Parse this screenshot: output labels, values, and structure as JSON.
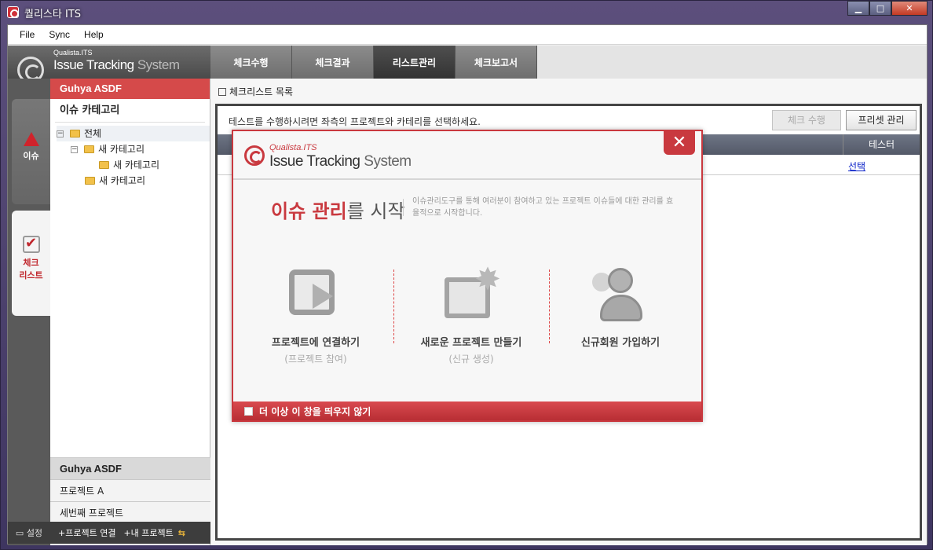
{
  "window": {
    "title": "퀄리스타 ITS",
    "btn_min": "▁",
    "btn_max": "□",
    "btn_close": "✕"
  },
  "menu": [
    "File",
    "Sync",
    "Help"
  ],
  "logo": {
    "small": "Qualista.ITS",
    "big_a": "Issue Tracking ",
    "big_b": "System"
  },
  "tabs": [
    "체크수행",
    "체크결과",
    "리스트관리",
    "체크보고서"
  ],
  "leftnav": {
    "issue": "이슈",
    "check_line1": "체크",
    "check_line2": "리스트"
  },
  "project_panel": {
    "header": "Guhya ASDF",
    "category_title": "이슈 카테고리",
    "tree": [
      {
        "label": "전체",
        "exp": "⊟"
      },
      {
        "label": "새 카테고리",
        "exp": "⊟"
      },
      {
        "label": "새 카테고리",
        "exp": ""
      },
      {
        "label": "새 카테고리",
        "exp": ""
      }
    ],
    "projects": [
      "Guhya ASDF",
      "프로젝트 A",
      "세번째 프로젝트"
    ]
  },
  "bottom_bar": {
    "settings": "설정",
    "connect": "+프로젝트 연결",
    "mine": "+내 프로젝트",
    "swap": "⇆"
  },
  "main": {
    "title": "체크리스트 목록",
    "instruction": "테스트를 수행하시려면 좌측의 프로젝트와 카테리를 선택하세요.",
    "btn_run": "체크 수행",
    "btn_preset": "프리셋 관리",
    "col_tester": "테스터",
    "row_link": "선택"
  },
  "modal": {
    "logo_small": "Qualista.ITS",
    "logo_big_a": "Issue Tracking ",
    "logo_big_b": "System",
    "close": "✕",
    "headline_red": "이슈 관리",
    "headline_rest": "를 시작",
    "desc": "이슈관리도구를 통해 여러분이 참여하고 있는 프로젝트 이슈들에 대한 관리를 효율적으로 시작합니다.",
    "options": [
      {
        "label": "프로젝트에 연결하기",
        "sub": "(프로젝트 참여)"
      },
      {
        "label": "새로운 프로젝트 만들기",
        "sub": "(신규 생성)"
      },
      {
        "label": "신규회원 가입하기",
        "sub": ""
      }
    ],
    "footer": "더 이상 이 창을 띄우지 않기"
  }
}
